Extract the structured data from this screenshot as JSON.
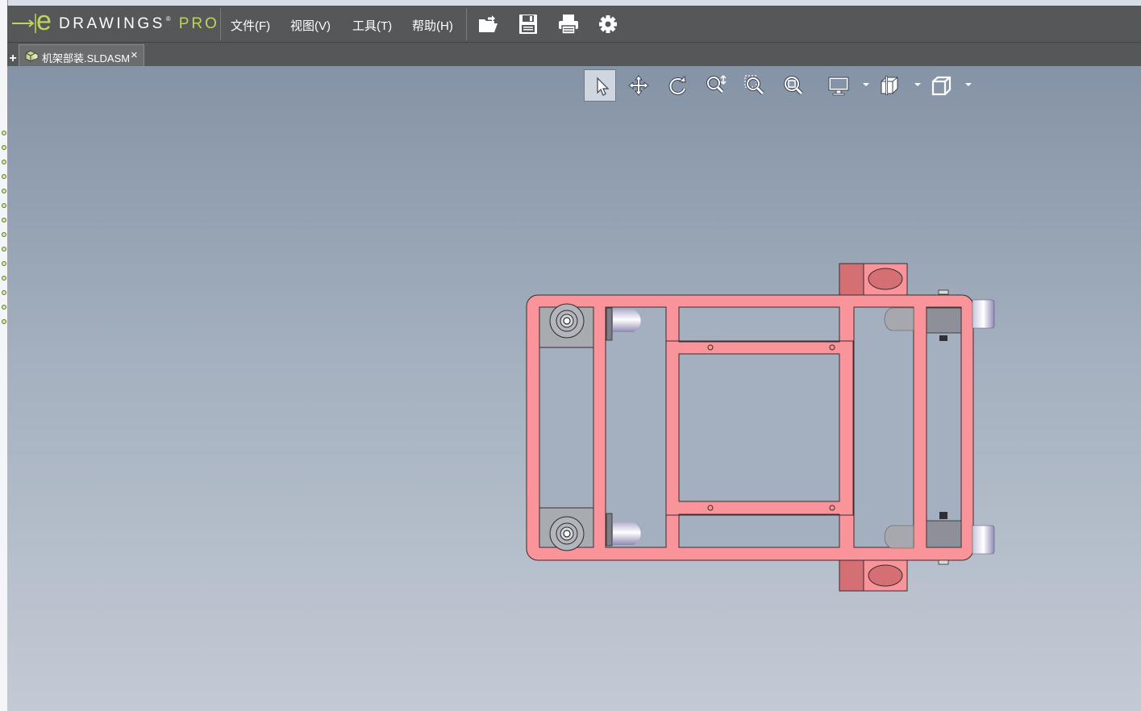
{
  "app": {
    "logo_e": "e",
    "logo_name": "DRAWINGS",
    "logo_reg": "®",
    "logo_edition": "PRO"
  },
  "menu": {
    "items": [
      "文件(F)",
      "视图(V)",
      "工具(T)",
      "帮助(H)"
    ]
  },
  "toolbar": {
    "icons": [
      "open-icon",
      "save-icon",
      "print-icon",
      "settings-icon"
    ]
  },
  "tabs": {
    "add_label": "+",
    "document": "机架部装.SLDASM",
    "close_label": "×"
  },
  "view_toolbar": {
    "tools": [
      "select-icon",
      "pan-icon",
      "rotate-icon",
      "zoom-icon",
      "zoom-area-icon",
      "zoom-fit-icon",
      "display-icon",
      "section-icon",
      "view-orientation-icon"
    ],
    "active_tool": "select-icon"
  },
  "colors": {
    "frame_pink": "#f9949a",
    "block_dark": "#d46f73",
    "menubar": "#555759",
    "viewport_top": "#8593a6",
    "viewport_bottom": "#c3cad4",
    "logo_green": "#bcd55a"
  }
}
